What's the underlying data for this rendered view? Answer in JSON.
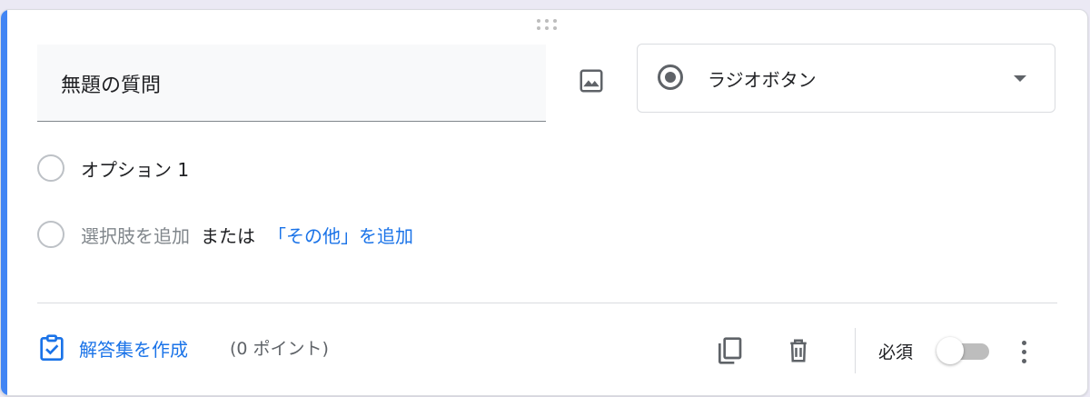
{
  "question": {
    "title": "無題の質問"
  },
  "question_type": {
    "selected": "ラジオボタン"
  },
  "options": [
    {
      "label": "オプション 1"
    }
  ],
  "add_option": {
    "label": "選択肢を追加",
    "or_text": "または",
    "other_label": "「その他」を追加"
  },
  "footer": {
    "answer_key_label": "解答集を作成",
    "points_label": "(0 ポイント)",
    "required_label": "必須",
    "required": false
  },
  "icons": {
    "drag": "drag-handle-icon",
    "image": "image-icon",
    "type_radio": "radio-checked-icon",
    "dropdown": "dropdown-arrow-icon",
    "answer_key": "assignment-check-icon",
    "copy": "copy-icon",
    "delete": "trash-icon",
    "more": "more-vert-icon"
  },
  "colors": {
    "accent": "#4285f4",
    "link": "#1a73e8",
    "icon": "#5f6368"
  }
}
